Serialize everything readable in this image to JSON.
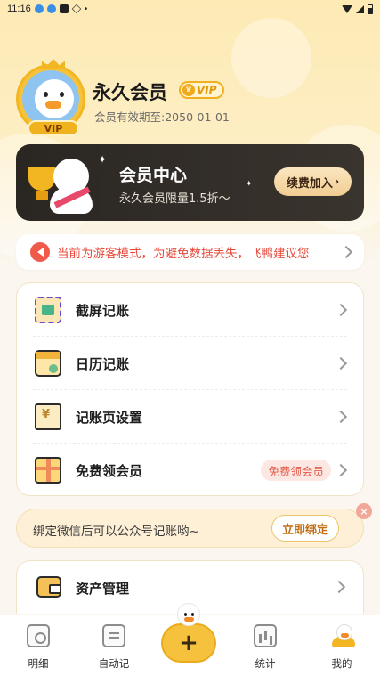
{
  "status_bar": {
    "time": "11:16"
  },
  "profile": {
    "title": "永久会员",
    "vip_badge": "VIP",
    "avatar_badge": "VIP",
    "expiry": "会员有效期至:2050-01-01"
  },
  "vip_card": {
    "title": "会员中心",
    "subtitle": "永久会员限量1.5折～",
    "button": "续费加入"
  },
  "notice": {
    "text": "当前为游客模式，为避免数据丢失，飞鸭建议您"
  },
  "menu": {
    "items": [
      {
        "label": "截屏记账",
        "icon": "screenshot-icon"
      },
      {
        "label": "日历记账",
        "icon": "calendar-icon"
      },
      {
        "label": "记账页设置",
        "icon": "ledger-page-icon"
      },
      {
        "label": "免费领会员",
        "icon": "gift-icon",
        "tag": "免费领会员"
      }
    ]
  },
  "bind": {
    "text": "绑定微信后可以公众号记账哟~",
    "button": "立即绑定",
    "close": "×"
  },
  "assets": {
    "label": "资产管理"
  },
  "bottom_nav": {
    "items": [
      {
        "label": "明细"
      },
      {
        "label": "自动记"
      },
      {
        "label": "统计"
      },
      {
        "label": "我的"
      }
    ],
    "add_symbol": "+"
  },
  "colors": {
    "accent": "#f6c23e",
    "notice_red": "#e9493b",
    "card_dark": "#2a2622"
  }
}
